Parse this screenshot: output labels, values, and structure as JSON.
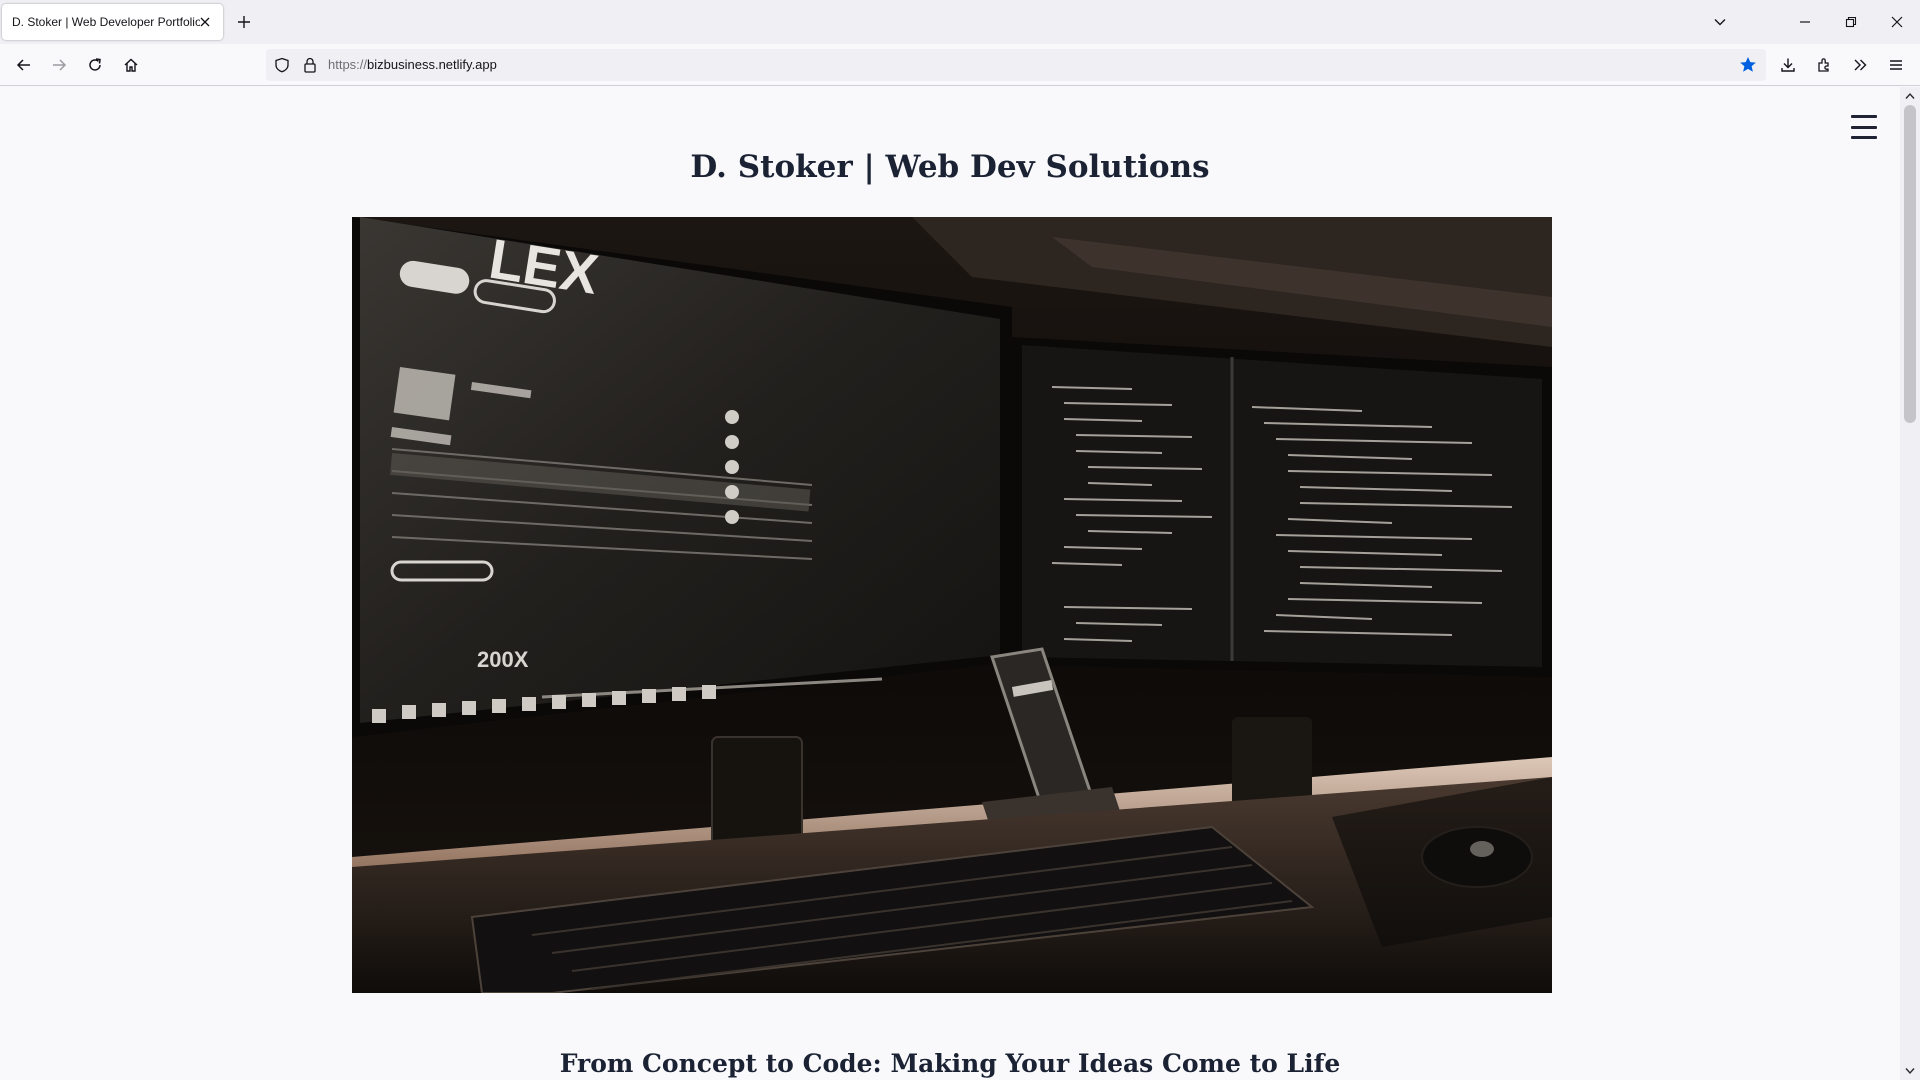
{
  "browser": {
    "tab_title": "D. Stoker | Web Developer Portfolio",
    "url_scheme": "https://",
    "url_host": "bizbusiness.netlify.app",
    "bookmark_star_color": "#0060df",
    "icons": [
      "close-icon",
      "plus-icon",
      "chevron-down-icon",
      "minimize-icon",
      "restore-icon",
      "window-close-icon",
      "back-icon",
      "forward-icon",
      "reload-icon",
      "home-icon",
      "shield-icon",
      "lock-icon",
      "star-icon",
      "download-icon",
      "extensions-icon",
      "overflow-icon",
      "menu-icon"
    ]
  },
  "page": {
    "title": "D. Stoker | Web Dev Solutions",
    "subheading": "From Concept to Code: Making Your Ideas Come to Life",
    "hero_image_screen_text_left": "LEX",
    "hero_image_screen_text_bottom": "200X",
    "text_color": "#1a2233"
  }
}
